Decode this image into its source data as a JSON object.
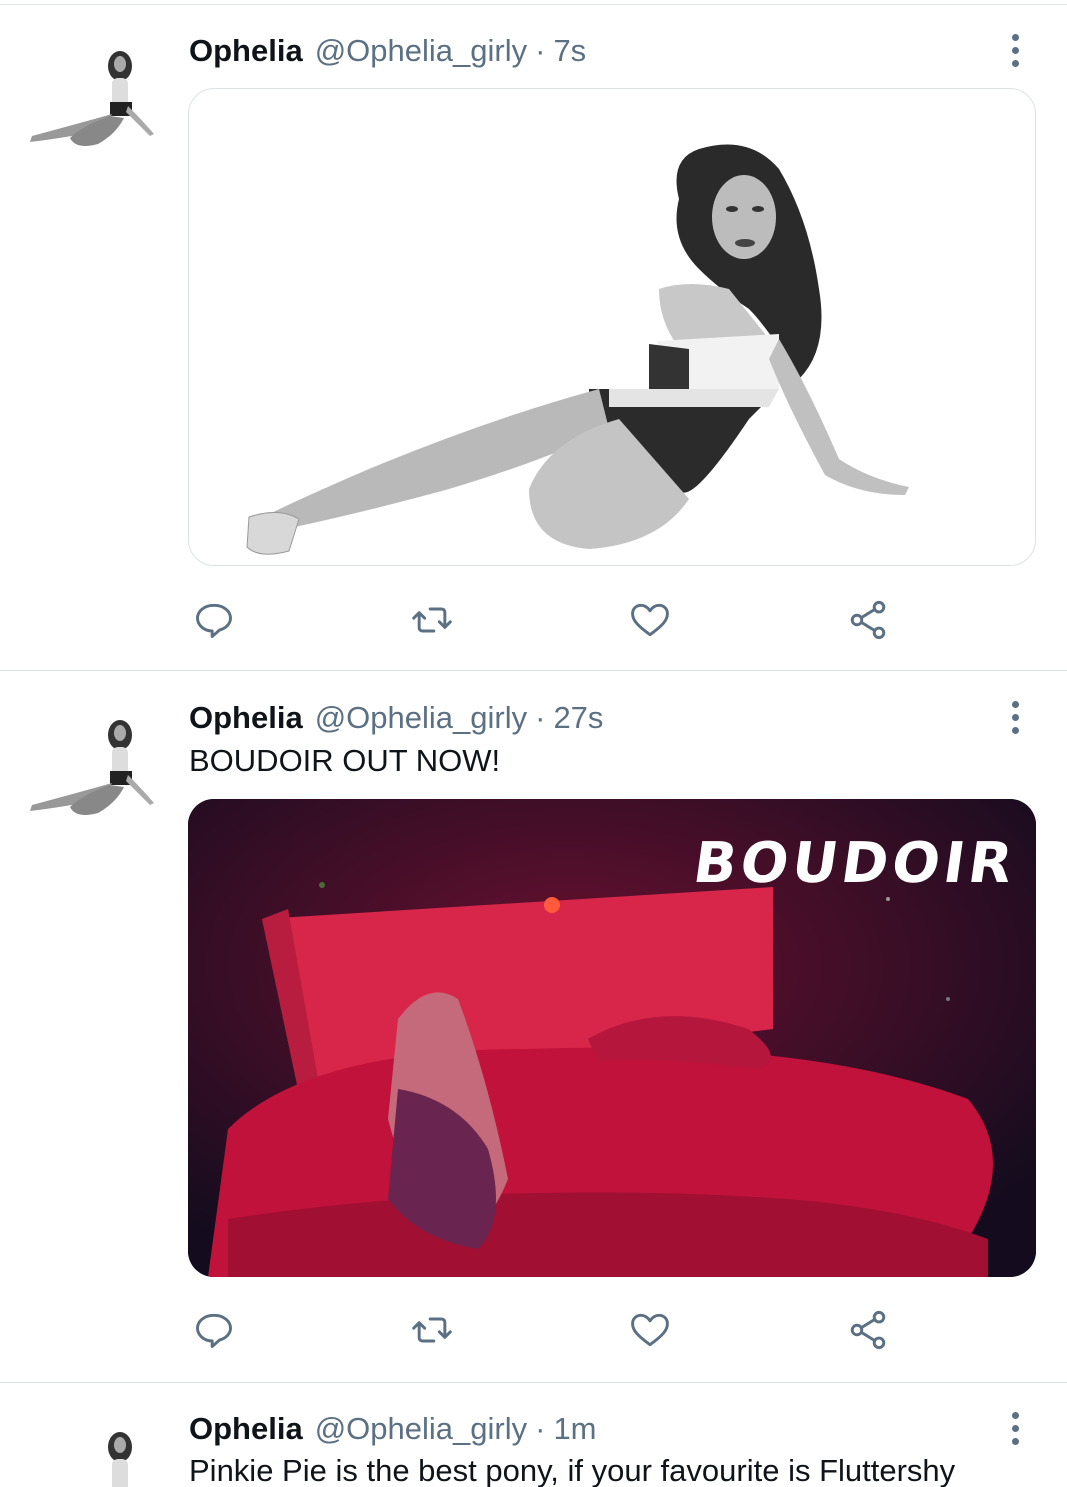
{
  "tweets": [
    {
      "name": "Ophelia",
      "handle": "@Ophelia_girly",
      "separator": "·",
      "time": "7s",
      "text": ""
    },
    {
      "name": "Ophelia",
      "handle": "@Ophelia_girly",
      "separator": "·",
      "time": "27s",
      "text": "BOUDOIR OUT NOW!",
      "media_title": "BOUDOIR"
    },
    {
      "name": "Ophelia",
      "handle": "@Ophelia_girly",
      "separator": "·",
      "time": "1m",
      "text": "Pinkie Pie is the best pony, if your favourite is Fluttershy"
    }
  ],
  "icons": {
    "reply": "speech-bubble-icon",
    "retweet": "retweet-icon",
    "like": "heart-icon",
    "share": "share-icon",
    "more": "vertical-dots-icon"
  },
  "colors": {
    "text": "#0f1419",
    "secondary": "#5b7083",
    "divider": "#dfe3e6",
    "media_dark": "#160f20",
    "media_red": "#c8123a"
  }
}
